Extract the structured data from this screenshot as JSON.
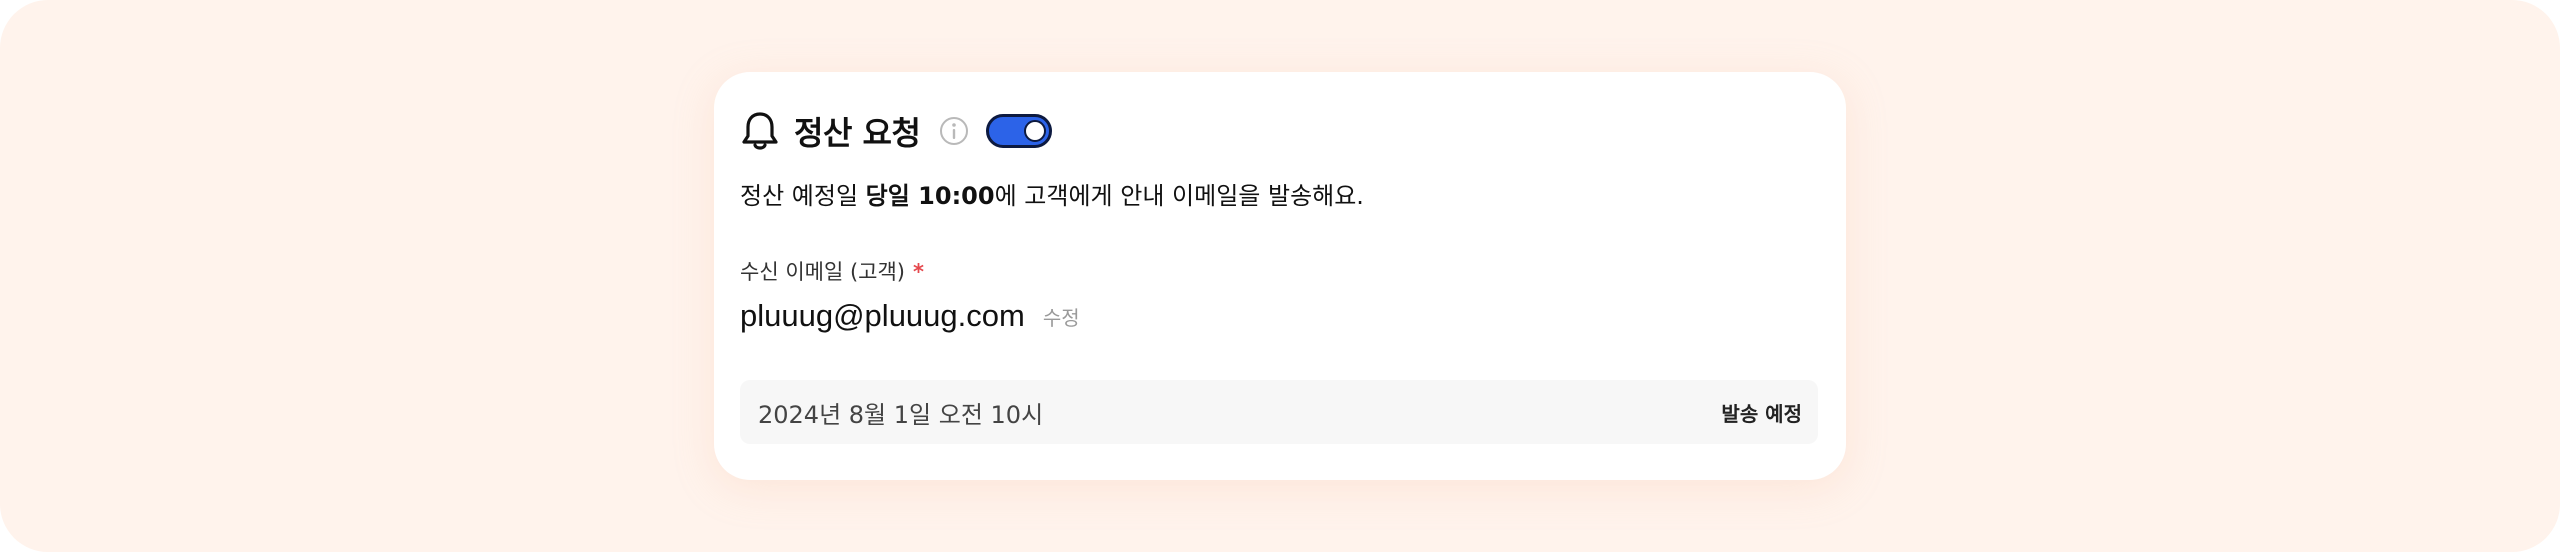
{
  "card": {
    "title": "정산 요청",
    "toggle_on": true,
    "description": {
      "prefix": "정산 예정일 ",
      "bold": "당일 10:00",
      "suffix": "에 고객에게 안내 이메일을 발송해요."
    },
    "recipient": {
      "label": "수신 이메일 (고객)",
      "required_mark": "*",
      "email": "pluuug@pluuug.com",
      "edit_label": "수정"
    },
    "schedule": {
      "date": "2024년 8월 1일 오전 10시",
      "status": "발송 예정"
    }
  },
  "icons": {
    "title_icon": "bell-icon",
    "info_icon": "info-icon"
  },
  "colors": {
    "background": "#fff3ec",
    "toggle_accent": "#2c63e8",
    "required": "#e5484d"
  }
}
